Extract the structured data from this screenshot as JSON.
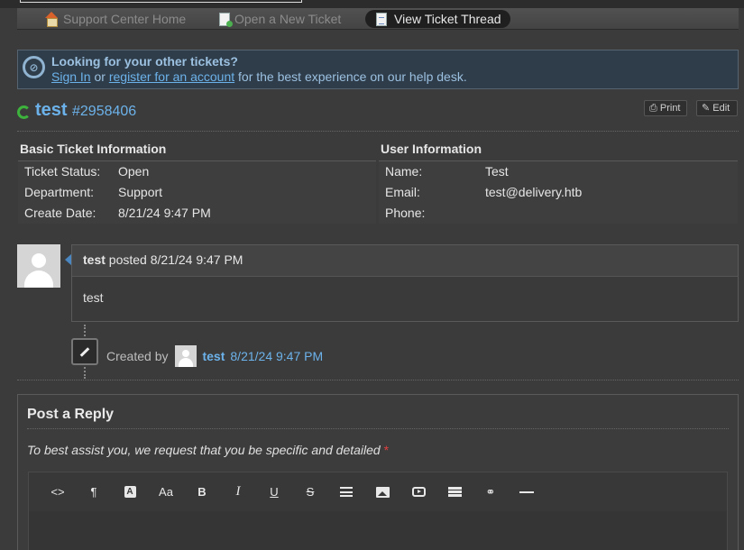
{
  "nav": {
    "home_label": "Support Center Home",
    "new_ticket_label": "Open a New Ticket",
    "view_thread_label": "View Ticket Thread"
  },
  "notice": {
    "title": "Looking for your other tickets?",
    "sign_in": "Sign In",
    "or": "or",
    "register": "register for an account",
    "suffix": "for the best experience on our help desk."
  },
  "ticket": {
    "subject": "test",
    "number": "#2958406",
    "print_label": "Print",
    "edit_label": "Edit"
  },
  "basic_info": {
    "heading": "Basic Ticket Information",
    "rows": [
      {
        "label": "Ticket Status:",
        "value": "Open"
      },
      {
        "label": "Department:",
        "value": "Support"
      },
      {
        "label": "Create Date:",
        "value": "8/21/24 9:47 PM"
      }
    ]
  },
  "user_info": {
    "heading": "User Information",
    "rows": [
      {
        "label": "Name:",
        "value": "Test"
      },
      {
        "label": "Email:",
        "value": "test@delivery.htb"
      },
      {
        "label": "Phone:",
        "value": ""
      }
    ]
  },
  "thread": {
    "author": "test",
    "posted": "posted",
    "time": "8/21/24 9:47 PM",
    "body": "test"
  },
  "event": {
    "created_by": "Created by",
    "author": "test",
    "time": "8/21/24 9:47 PM"
  },
  "reply": {
    "title": "Post a Reply",
    "hint": "To best assist you, we request that you be specific and detailed",
    "required_mark": "*",
    "toolbar": [
      "code-view",
      "paragraph",
      "font-color",
      "font-size",
      "bold",
      "italic",
      "underline",
      "strikethrough",
      "list",
      "image",
      "video",
      "table",
      "link",
      "horizontal-rule"
    ],
    "tb_labels": {
      "code": "<>",
      "para": "¶",
      "fc": "A",
      "fs": "Aa",
      "b": "B",
      "i": "I",
      "u": "U",
      "s": "S"
    }
  },
  "colors": {
    "link": "#6cb2ea",
    "background": "#3b3b3b",
    "refresh": "#3db33d"
  }
}
